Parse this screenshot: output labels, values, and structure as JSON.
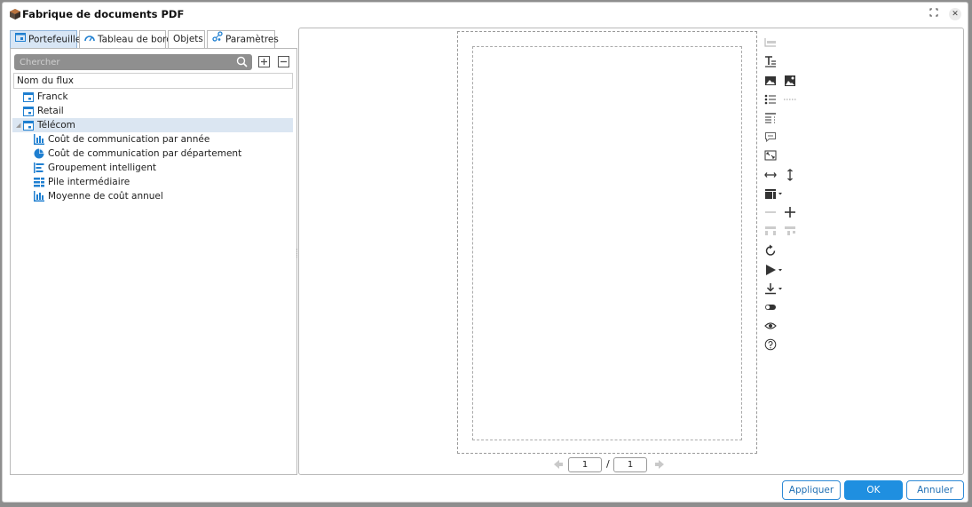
{
  "window": {
    "title": "Fabrique de documents PDF",
    "expand_icon": "expand-icon",
    "close_icon": "close-icon"
  },
  "tabs": [
    {
      "label": "Portefeuille",
      "icon": "portfolio-icon",
      "active": true
    },
    {
      "label": "Tableau de bord",
      "icon": "dashboard-gauge-icon",
      "active": false
    },
    {
      "label": "Objets",
      "icon": "",
      "active": false
    },
    {
      "label": "Paramètres",
      "icon": "settings-nodes-icon",
      "active": false
    }
  ],
  "search": {
    "placeholder": "Chercher",
    "value": ""
  },
  "tree": {
    "column_header": "Nom du flux",
    "items": [
      {
        "label": "Franck",
        "icon": "folder-icon",
        "level": 0
      },
      {
        "label": "Retail",
        "icon": "folder-icon",
        "level": 0
      },
      {
        "label": "Télécom",
        "icon": "folder-icon",
        "level": 0,
        "expanded": true,
        "selected": true
      },
      {
        "label": "Coût de communication par année",
        "icon": "bar-chart-icon",
        "level": 1
      },
      {
        "label": "Coût de communication par département",
        "icon": "pie-chart-icon",
        "level": 1
      },
      {
        "label": "Groupement intelligent",
        "icon": "grouped-bar-icon",
        "level": 1
      },
      {
        "label": "Pile intermédiaire",
        "icon": "stacked-bar-icon",
        "level": 1
      },
      {
        "label": "Moyenne de coût annuel",
        "icon": "bar-chart-icon",
        "level": 1
      }
    ]
  },
  "pager": {
    "current_page": "1",
    "separator": "/",
    "total_pages": "1"
  },
  "buttons": {
    "apply": "Appliquer",
    "ok": "OK",
    "cancel": "Annuler"
  },
  "colors": {
    "accent": "#1f8fe0",
    "icon_blue": "#1f7fd0",
    "selected_row": "#dbe6f2"
  }
}
